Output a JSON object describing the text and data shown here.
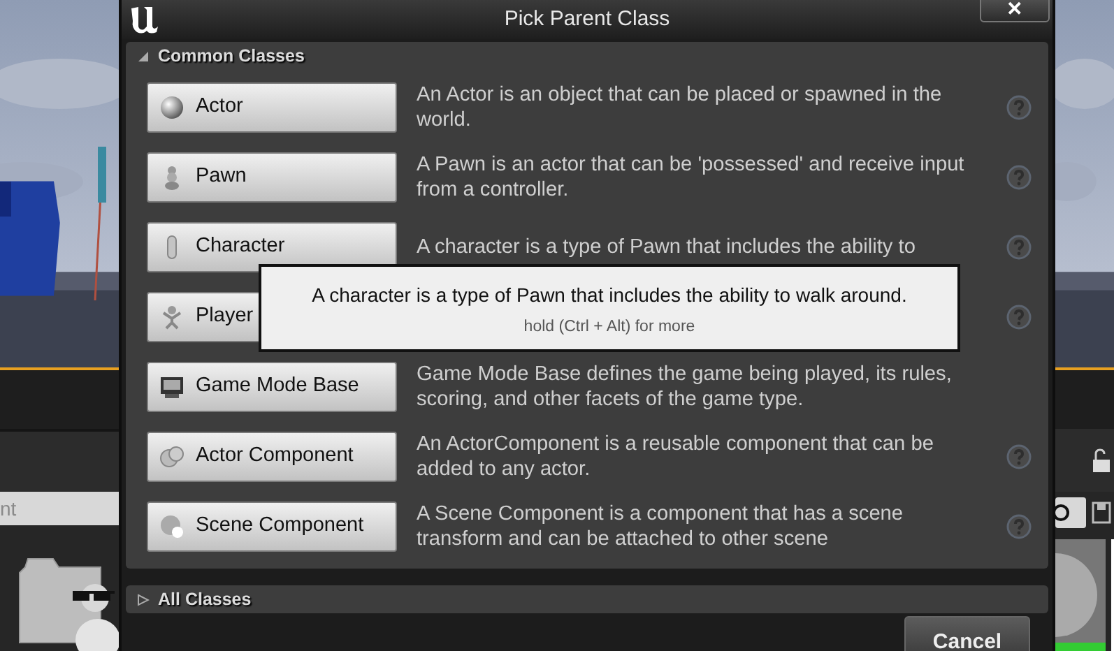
{
  "window": {
    "title": "Pick Parent Class",
    "close": "✕"
  },
  "common_classes": {
    "label": "Common Classes",
    "expanded": true,
    "items": [
      {
        "label": "Actor",
        "description": "An Actor is an object that can be placed or spawned in the world.",
        "help": true
      },
      {
        "label": "Pawn",
        "description": "A Pawn is an actor that can be 'possessed' and receive input from a controller.",
        "help": true
      },
      {
        "label": "Character",
        "description": "A character is a type of Pawn that includes the ability to",
        "help": true
      },
      {
        "label": "Player",
        "help": true
      },
      {
        "label": "Game Mode Base",
        "description": "Game Mode Base defines the game being played, its rules, scoring, and other facets of the game type.",
        "help": false
      },
      {
        "label": "Actor Component",
        "description": "An ActorComponent is a reusable component that can be added to any actor.",
        "help": true
      },
      {
        "label": "Scene Component",
        "description": "A Scene Component is a component that has a scene transform and can be attached to other scene",
        "help": true
      }
    ]
  },
  "tooltip": {
    "text": "A character is a type of Pawn that includes the ability to walk around.",
    "hint": "hold (Ctrl + Alt) for more"
  },
  "all_classes": {
    "label": "All Classes",
    "expanded": false
  },
  "buttons": [
    "Cancel"
  ],
  "background": {
    "search": {
      "placeholder": "nt"
    }
  }
}
